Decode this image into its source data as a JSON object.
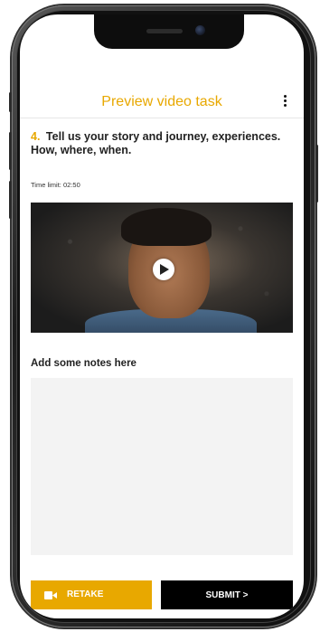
{
  "header": {
    "title": "Preview video task",
    "menu_icon": "kebab-menu-icon"
  },
  "question": {
    "number": "4.",
    "text": "Tell us your story and journey, experiences. How, where, when."
  },
  "time_limit": "Time limit: 02:50",
  "video": {
    "play_icon": "play-icon"
  },
  "notes": {
    "label": "Add some notes here",
    "value": ""
  },
  "actions": {
    "retake_label": "RETAKE",
    "retake_icon": "video-camera-icon",
    "submit_label": "SUBMIT >"
  },
  "colors": {
    "accent": "#e8a800",
    "submit_bg": "#000000",
    "notes_bg": "#f3f3f3"
  }
}
